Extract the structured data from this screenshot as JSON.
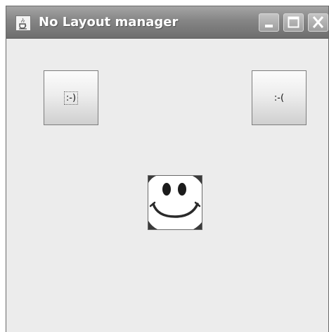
{
  "window": {
    "title": "No Layout manager",
    "icons": {
      "app": "java-cup-icon",
      "minimize": "minimize-icon",
      "maximize": "maximize-icon",
      "close": "close-icon"
    }
  },
  "content": {
    "happy_button_label": ":-)",
    "sad_button_label": ":-(",
    "image_icon": "smiley-face-icon"
  }
}
